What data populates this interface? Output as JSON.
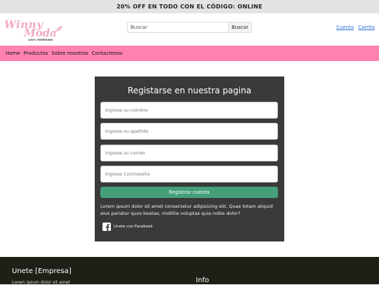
{
  "promo": {
    "text": "20% OFF EN TODO CON EL CÓDIGO: ONLINE"
  },
  "brand": {
    "line1": "Winny",
    "line2": "Moda",
    "tagline": "100% FEMENINO"
  },
  "search": {
    "placeholder": "Buscar",
    "button_label": "Buscar"
  },
  "header_links": {
    "account": "Cuenta",
    "cart": "Carrito"
  },
  "nav": {
    "items": [
      "Home",
      "Productos",
      "Sobre nosotros",
      "Contactenos"
    ]
  },
  "form": {
    "title": "Registarse en nuestra pagina",
    "name_placeholder": "Ingrese su nombre",
    "lastname_placeholder": "Ingrese su apellido",
    "email_placeholder": "Ingrese su correo",
    "password_placeholder": "Ingrese Contraseña",
    "submit_label": "Registrar cuenta",
    "description": "Lorem ipsum dolor sit amet consectetur adipisicing elit. Quae totam aliquid eius pariatur quos beatae, mollitia voluptas quia nobis dolor?",
    "facebook_label": "Unete con Facebook"
  },
  "footer": {
    "title": "Unete [Empresa]",
    "text": "Lorem ipsum dolor sit amet",
    "info_title": "Info"
  },
  "colors": {
    "promo_bg": "#e3e3e1",
    "nav_bg": "#ff82b0",
    "card_bg": "#3a3a3a",
    "submit_bg": "#45a07a",
    "footer_bg": "#1f1e17",
    "brand_pink": "#f2a9c4",
    "link_blue": "#2a6fd6"
  },
  "icons": {
    "logo_leaf": "leaf-icon",
    "facebook": "facebook-icon"
  }
}
